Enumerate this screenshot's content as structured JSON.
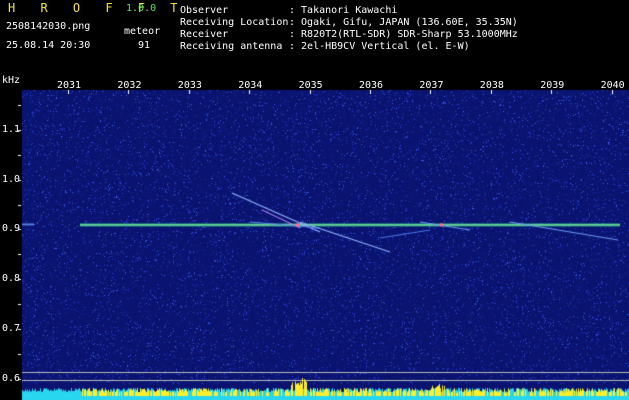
{
  "header": {
    "brand": "H R O F F T",
    "version": "1.0.0",
    "filename": "2508142030.png",
    "datetime": "25.08.14 20:30",
    "mode_label": "meteor",
    "count": "91",
    "info": [
      {
        "label": "Observer",
        "value": ": Takanori Kawachi"
      },
      {
        "label": "Receiving Location",
        "value": ": Ogaki, Gifu, JAPAN (136.60E, 35.35N)"
      },
      {
        "label": "Receiver",
        "value": ": R820T2(RTL-SDR) SDR-Sharp 53.1000MHz"
      },
      {
        "label": "Receiving antenna",
        "value": ": 2el-HB9CV Vertical (el. E-W)"
      }
    ]
  },
  "spectrogram": {
    "y_unit": "kHz",
    "y_ticks": [
      "1.1",
      "1.0",
      "0.9",
      "0.8",
      "0.7",
      "0.6"
    ],
    "y_values": [
      1.1,
      1.0,
      0.9,
      0.8,
      0.7,
      0.6
    ],
    "x_ticks": [
      "2031",
      "2032",
      "2033",
      "2034",
      "2035",
      "2036",
      "2037",
      "2038",
      "2039",
      "2040"
    ],
    "carrier_khz": 0.91,
    "colors": {
      "background": "#0a1470",
      "carrier": "#a0f0b0",
      "echo": "#8fb4ff",
      "bar_cyan": "#28d6f0",
      "bar_yellow": "#ffee28",
      "guide_line": "#b8b8b8"
    }
  }
}
